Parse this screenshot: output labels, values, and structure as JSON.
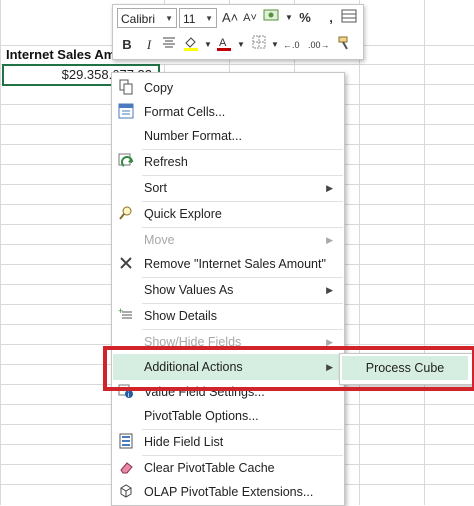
{
  "sheet": {
    "header_cell": "Internet Sales Amo...",
    "value_cell": "$29.358.677,22"
  },
  "mini_toolbar": {
    "font_name": "Calibri",
    "font_size": "11",
    "grow_font": "A˄",
    "shrink_font": "A˅",
    "percent": "%",
    "comma": ",",
    "bold": "B",
    "italic": "I",
    "increase_decimal": "←.0",
    "decrease_decimal": ".00→"
  },
  "menu": {
    "items": [
      {
        "label": "Copy",
        "icon": "copy-icon"
      },
      {
        "label": "Format Cells...",
        "icon": "format-cells-icon"
      },
      {
        "label": "Number Format...",
        "icon": ""
      },
      {
        "label": "Refresh",
        "icon": "refresh-icon"
      },
      {
        "label": "Sort",
        "icon": ""
      },
      {
        "label": "Quick Explore",
        "icon": "quick-explore-icon"
      },
      {
        "label": "Move",
        "icon": ""
      },
      {
        "label": "Remove \"Internet Sales Amount\"",
        "icon": "remove-icon"
      },
      {
        "label": "Show Values As",
        "icon": ""
      },
      {
        "label": "Show Details",
        "icon": "show-details-icon"
      },
      {
        "label": "Show/Hide Fields",
        "icon": ""
      },
      {
        "label": "Additional Actions",
        "icon": ""
      },
      {
        "label": "Value Field Settings...",
        "icon": "value-field-settings-icon"
      },
      {
        "label": "PivotTable Options...",
        "icon": ""
      },
      {
        "label": "Hide Field List",
        "icon": "field-list-icon"
      },
      {
        "label": "Clear PivotTable Cache",
        "icon": "eraser-icon"
      },
      {
        "label": "OLAP PivotTable Extensions...",
        "icon": "cube-icon"
      }
    ]
  },
  "submenu": {
    "item": "Process Cube"
  },
  "colors": {
    "highlight": "#d6eee1",
    "annotation": "#d1232a",
    "selection_border": "#217346"
  }
}
